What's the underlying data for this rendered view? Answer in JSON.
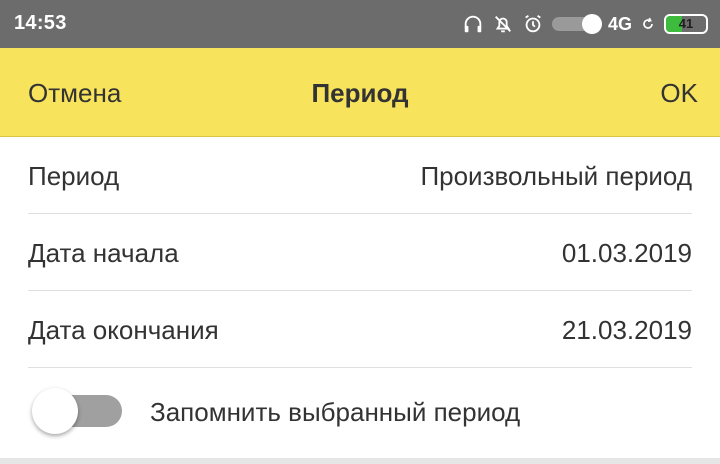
{
  "status_bar": {
    "time": "14:53",
    "network": "4G",
    "battery": "41",
    "icons": [
      "headphones-icon",
      "alarm-off-icon",
      "alarm-icon",
      "sync-icon"
    ]
  },
  "app_bar": {
    "cancel_label": "Отмена",
    "title": "Период",
    "ok_label": "OK",
    "background": "#f7e35c"
  },
  "fields": [
    {
      "label": "Период",
      "value": "Произвольный период"
    },
    {
      "label": "Дата начала",
      "value": "01.03.2019"
    },
    {
      "label": "Дата окончания",
      "value": "21.03.2019"
    }
  ],
  "remember": {
    "label": "Запомнить выбранный период",
    "enabled": false
  }
}
